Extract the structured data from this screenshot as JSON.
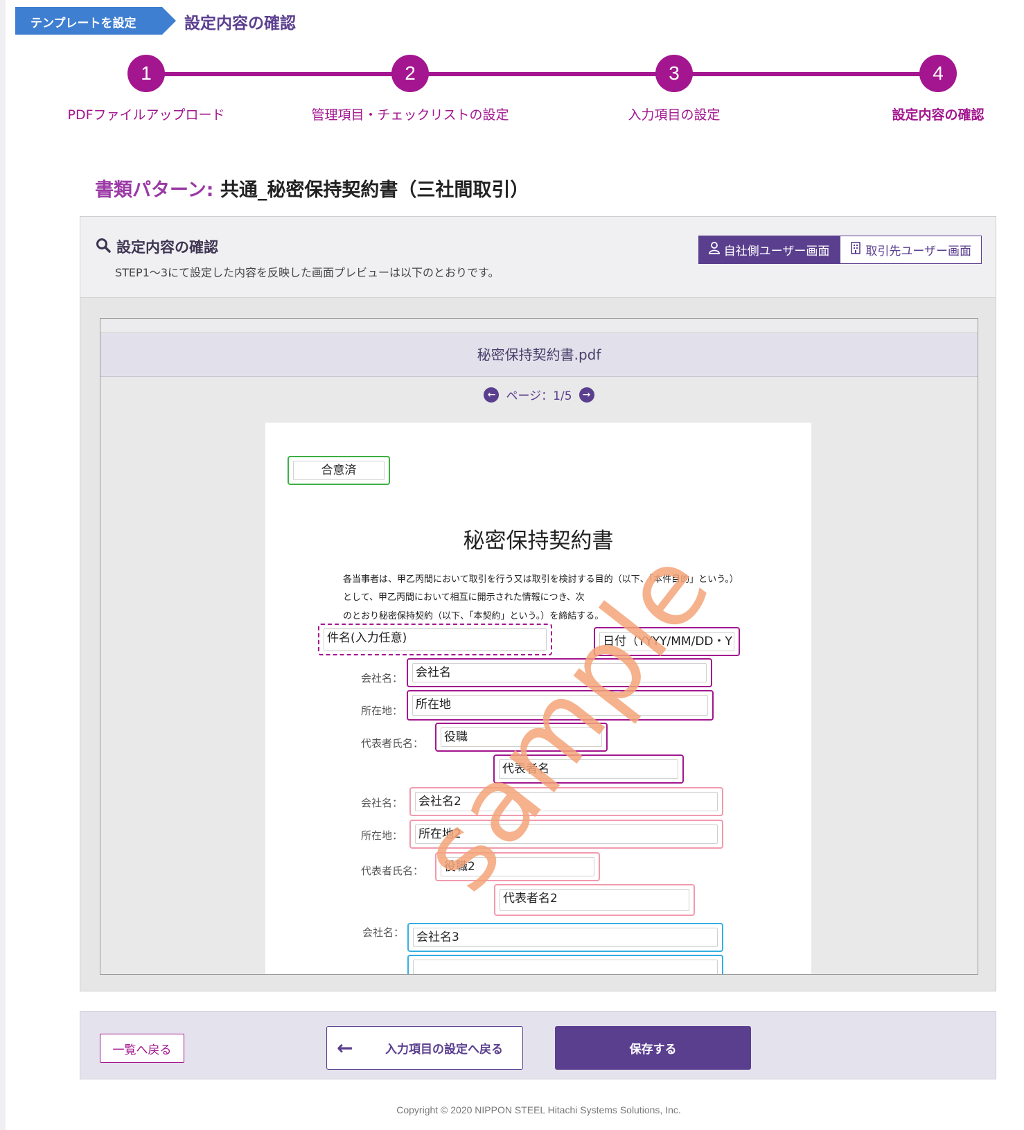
{
  "breadcrumb": {
    "parent": "テンプレートを設定",
    "current": "設定内容の確認"
  },
  "stepper": {
    "steps": [
      {
        "number": "1",
        "label": "PDFファイルアップロード"
      },
      {
        "number": "2",
        "label": "管理項目・チェックリストの設定"
      },
      {
        "number": "3",
        "label": "入力項目の設定"
      },
      {
        "number": "4",
        "label": "設定内容の確認"
      }
    ],
    "active_step": 4,
    "color": "#a3168f"
  },
  "pattern": {
    "label": "書類パターン:",
    "name": "共通_秘密保持契約書（三社間取引）"
  },
  "panel": {
    "title": "設定内容の確認",
    "subtitle": "STEP1〜3にて設定した内容を反映した画面プレビューは以下のとおりです。",
    "toggle": {
      "own_user": "自社側ユーザー画面",
      "partner_user": "取引先ユーザー画面",
      "selected": "own_user"
    }
  },
  "viewer": {
    "file_name": "秘密保持契約書.pdf",
    "page_label": "ページ：1/5",
    "document": {
      "title": "秘密保持契約書",
      "paragraph": [
        "各当事者は、甲乙丙間において取引を行う又は取引を検討する目的（以下、「本件目的」という。）",
        "として、甲乙丙間において相互に開示された情報につき、次",
        "のとおり秘密保持契約（以下、「本契約」という。）を締結する。"
      ],
      "labels": {
        "company": "会社名：",
        "address": "所在地：",
        "representative": "代表者氏名："
      },
      "fields": {
        "agreed": "合意済",
        "subject": "件名(入力任意)",
        "date": "日付（YYYY/MM/DD・Y",
        "company1": "会社名",
        "address1": "所在地",
        "title1": "役職",
        "rep1": "代表者名",
        "company2": "会社名2",
        "address2": "所在地2",
        "title2": "役職2",
        "rep2": "代表者名2",
        "company3": "会社名3"
      },
      "watermark": "sample"
    }
  },
  "actions": {
    "back_to_list": "一覧へ戻る",
    "back_to_input": "入力項目の設定へ戻る",
    "save": "保存する"
  },
  "footer": "Copyright © 2020 NIPPON STEEL Hitachi Systems Solutions, Inc.",
  "colors": {
    "primary": "#5b3f8f",
    "accent": "#a3168f",
    "breadcrumb": "#3f7fd1"
  }
}
